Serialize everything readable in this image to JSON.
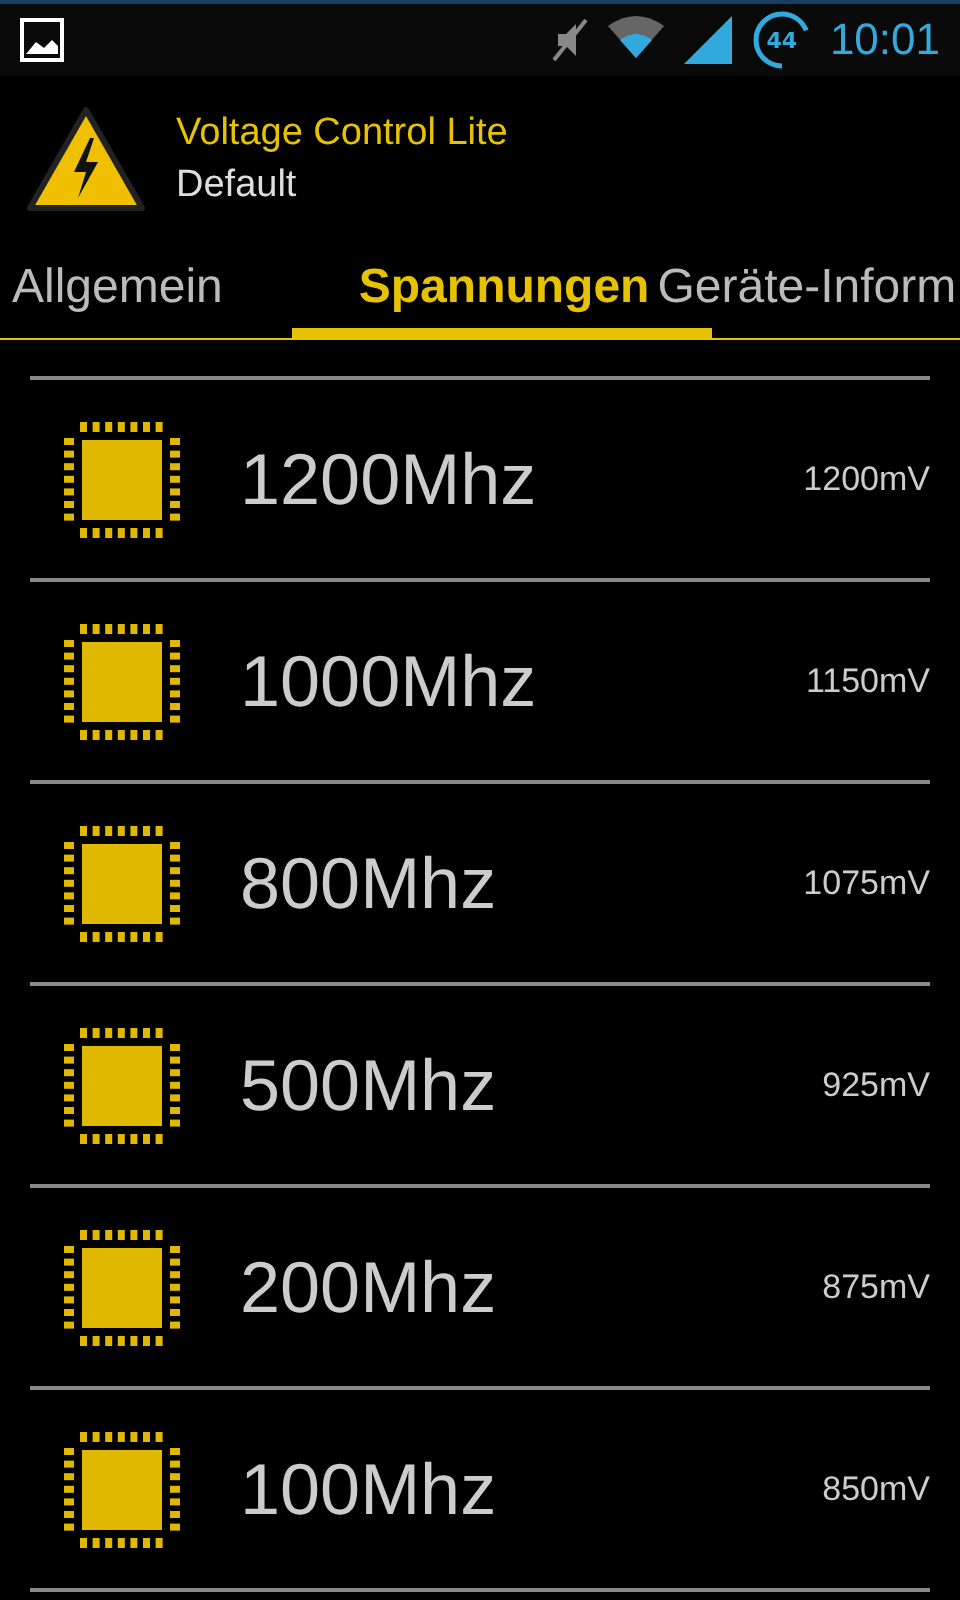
{
  "status_bar": {
    "battery": "44",
    "time": "10:01"
  },
  "app_header": {
    "title": "Voltage Control Lite",
    "subtitle": "Default"
  },
  "tabs": [
    {
      "label": "Allgemein",
      "selected": false
    },
    {
      "label": "Spannungen",
      "selected": true
    },
    {
      "label": "Geräte-Inform",
      "selected": false
    }
  ],
  "frequencies": [
    {
      "frequency": "1200Mhz",
      "voltage": "1200mV"
    },
    {
      "frequency": "1000Mhz",
      "voltage": "1150mV"
    },
    {
      "frequency": "800Mhz",
      "voltage": "1075mV"
    },
    {
      "frequency": "500Mhz",
      "voltage": "925mV"
    },
    {
      "frequency": "200Mhz",
      "voltage": "875mV"
    },
    {
      "frequency": "100Mhz",
      "voltage": "850mV"
    }
  ]
}
